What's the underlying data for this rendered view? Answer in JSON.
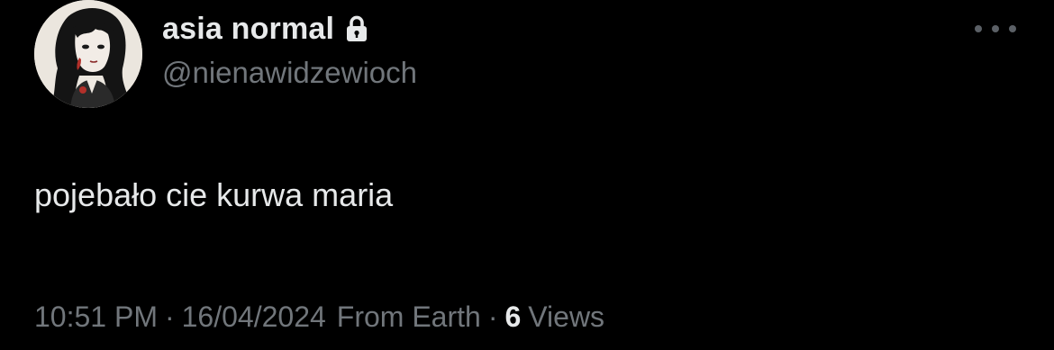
{
  "tweet": {
    "display_name": "asia normal",
    "handle": "@nienawidzewioch",
    "text": "pojebało cie kurwa maria",
    "time": "10:51 PM",
    "date": "16/04/2024",
    "source": "From Earth",
    "separator": "·",
    "views_count": "6",
    "views_label": "Views"
  },
  "icons": {
    "lock": "lock-icon",
    "more": "more-icon"
  },
  "colors": {
    "background": "#000000",
    "primary_text": "#e7e9ea",
    "secondary_text": "#71767b"
  }
}
